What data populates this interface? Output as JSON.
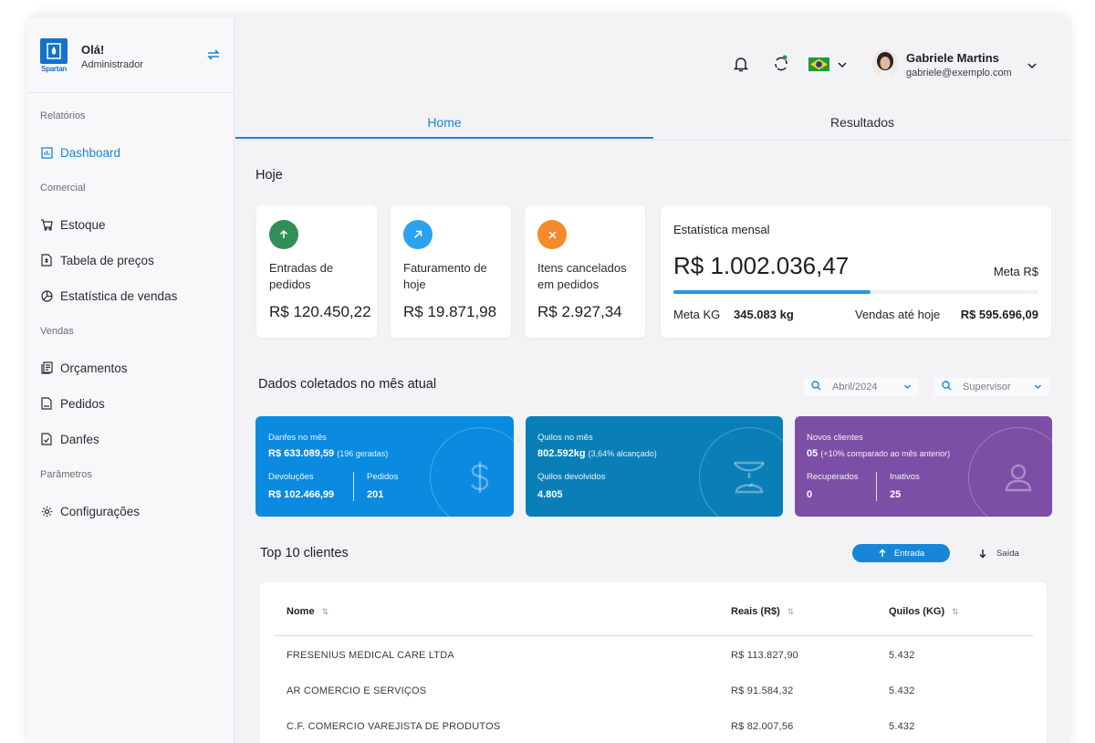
{
  "brand": {
    "logo_text": "Spartan"
  },
  "sidebar": {
    "greeting": "Olá!",
    "role": "Administrador",
    "sections": {
      "relatorios": "Relatórios",
      "comercial": "Comercial",
      "vendas": "Vendas",
      "parametros": "Parâmetros"
    },
    "items": {
      "dashboard": "Dashboard",
      "estoque": "Estoque",
      "tabela": "Tabela de preços",
      "estatistica": "Estatística de vendas",
      "orcamentos": "Orçamentos",
      "pedidos": "Pedidos",
      "danfes": "Danfes",
      "configuracoes": "Configurações"
    }
  },
  "user": {
    "name": "Gabriele Martins",
    "email": "gabriele@exemplo.com"
  },
  "tabs": {
    "home": "Home",
    "resultados": "Resultados"
  },
  "today": {
    "title": "Hoje",
    "kpis": [
      {
        "title": "Entradas de pedidos",
        "value": "R$ 120.450,22",
        "color": "#2f8f57",
        "icon": "arrow-up-icon"
      },
      {
        "title": "Faturamento de hoje",
        "value": "R$ 19.871,98",
        "color": "#2aa3ee",
        "icon": "arrow-up-right-icon"
      },
      {
        "title": "Itens cancelados em pedidos",
        "value": "R$ 2.927,34",
        "color": "#f5892b",
        "icon": "close-icon"
      }
    ],
    "monthly": {
      "title": "Estatística mensal",
      "value": "R$ 1.002.036,47",
      "meta_label": "Meta R$",
      "progress": 0.54,
      "meta_kg_label": "Meta KG",
      "meta_kg_value": "345.083 kg",
      "sales_label": "Vendas até hoje",
      "sales_value": "R$ 595.696,09"
    }
  },
  "month": {
    "title": "Dados coletados no mês atual",
    "filter_month": "Abril/2024",
    "filter_supervisor": "Supervisor",
    "cards": {
      "danfes": {
        "label": "Danfes no mês",
        "value": "R$ 633.089,59",
        "sub": "(196 geradas)",
        "l1": "Devoluções",
        "v1": "R$ 102.466,99",
        "l2": "Pedidos",
        "v2": "201",
        "color": "#0a8be0"
      },
      "quilos": {
        "label": "Quilos no mês",
        "value": "802.592kg",
        "sub": "(3,64% alcançado)",
        "l1": "Quilos devolvidos",
        "v1": "4.805",
        "color": "#0a7fb7"
      },
      "clientes": {
        "label": "Novos clientes",
        "value": "05",
        "sub": "(+10% comparado ao mês anterior)",
        "l1": "Recuperados",
        "v1": "0",
        "l2": "Inativos",
        "v2": "25",
        "color": "#7b4fa6"
      }
    }
  },
  "top": {
    "title": "Top 10 clientes",
    "btn_entrada": "Entrada",
    "btn_saida": "Saída",
    "columns": [
      "Nome",
      "Reais (R$)",
      "Quilos (KG)"
    ],
    "rows": [
      [
        "FRESENIUS MEDICAL CARE LTDA",
        "R$ 113.827,90",
        "5.432"
      ],
      [
        "AR COMERCIO E SERVIÇOS",
        "R$ 91.584,32",
        "5.432"
      ],
      [
        "C.F. COMERCIO VAREJISTA DE PRODUTOS",
        "R$ 82.007,56",
        "5.432"
      ]
    ]
  }
}
